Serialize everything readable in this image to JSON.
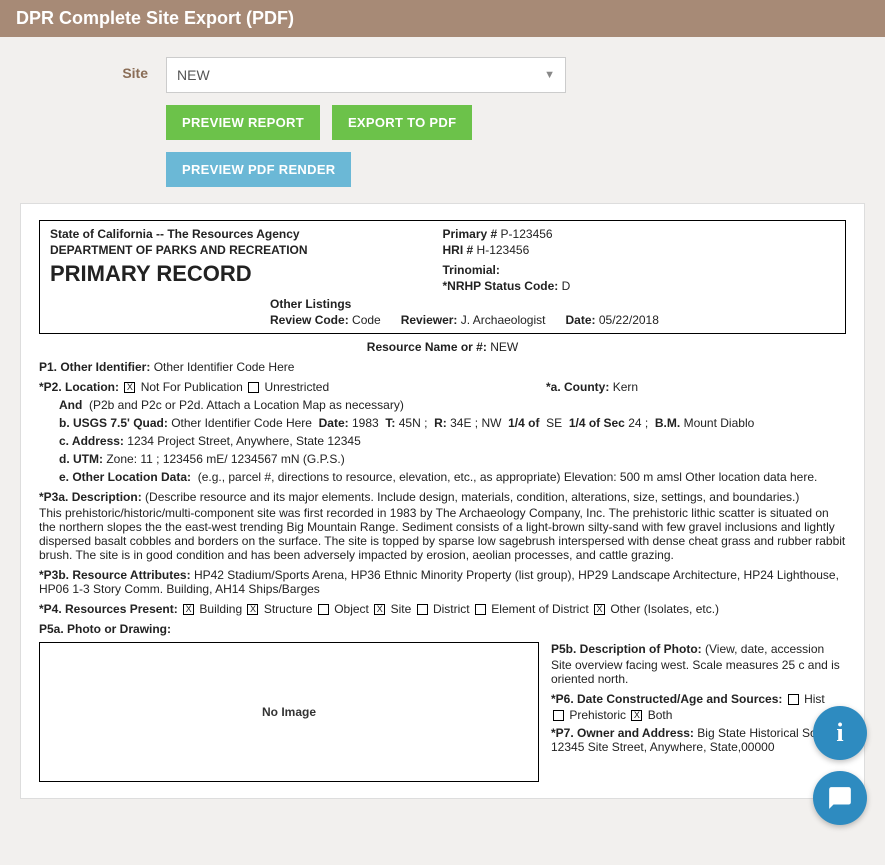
{
  "header": {
    "title": "DPR Complete Site Export (PDF)"
  },
  "controls": {
    "site_label": "Site",
    "site_value": "NEW",
    "btn_preview": "PREVIEW REPORT",
    "btn_export": "EXPORT TO PDF",
    "btn_render": "PREVIEW PDF RENDER"
  },
  "doc": {
    "agency": "State of California -- The Resources Agency",
    "dept": "DEPARTMENT OF PARKS AND RECREATION",
    "rec_title": "PRIMARY RECORD",
    "primary_label": "Primary #",
    "primary_val": "P-123456",
    "hri_label": "HRI #",
    "hri_val": "H-123456",
    "trinomial_label": "Trinomial:",
    "nrhp_label": "*NRHP Status Code:",
    "nrhp_val": "D",
    "other_listings": "Other Listings",
    "review_code_label": "Review Code:",
    "review_code_val": "Code",
    "reviewer_label": "Reviewer:",
    "reviewer_val": "J. Archaeologist",
    "date_label": "Date:",
    "date_val": "05/22/2018",
    "resname_label": "Resource Name or #:",
    "resname_val": "NEW",
    "p1_label": "P1. Other Identifier:",
    "p1_val": "Other Identifier Code Here",
    "p2_label": "*P2. Location:",
    "p2_nfp": "Not For Publication",
    "p2_unr": "Unrestricted",
    "p2a_label": "*a. County:",
    "p2a_val": "Kern",
    "p2_and": "And",
    "p2_and_note": "(P2b and P2c or P2d. Attach a Location Map as necessary)",
    "p2b_label": "b. USGS 7.5' Quad:",
    "p2b_val": "Other Identifier Code Here",
    "p2b_date_label": "Date:",
    "p2b_date_val": "1983",
    "p2b_t_label": "T:",
    "p2b_t_val": "45N ;",
    "p2b_r_label": "R:",
    "p2b_r_val": "34E ;  NW",
    "p2b_q1": "1/4 of",
    "p2b_q1_val": "SE",
    "p2b_q2": "1/4 of Sec",
    "p2b_q2_val": "24 ;",
    "p2b_bm_label": "B.M.",
    "p2b_bm_val": "Mount Diablo",
    "p2c_label": "c. Address:",
    "p2c_val": "1234 Project Street, Anywhere, State 12345",
    "p2d_label": "d. UTM:",
    "p2d_val": "Zone: 11 ; 123456 mE/ 1234567 mN (G.P.S.)",
    "p2e_label": "e. Other Location Data:",
    "p2e_note": "(e.g., parcel #, directions to resource, elevation, etc., as appropriate)  Elevation: 500 m amsl  Other location data here.",
    "p3a_label": "*P3a. Description:",
    "p3a_note": "(Describe resource and its major elements. Include design, materials, condition, alterations, size, settings, and boundaries.)",
    "p3a_body": "This prehistoric/historic/multi-component site was first recorded in 1983 by The Archaeology Company, Inc. The prehistoric lithic scatter is situated on the northern slopes the the east-west trending Big Mountain Range. Sediment consists of a light-brown silty-sand with few gravel inclusions and lightly dispersed basalt cobbles and borders on the surface. The site is topped by sparse low sagebrush interspersed with dense cheat grass and rubber rabbit brush. The site is in good condition and has been adversely impacted by erosion, aeolian processes, and cattle grazing.",
    "p3b_label": "*P3b. Resource Attributes:",
    "p3b_val": "HP42 Stadium/Sports Arena, HP36 Ethnic Minority Property (list group), HP29 Landscape Architecture, HP24 Lighthouse, HP06 1-3 Story Comm. Building, AH14 Ships/Barges",
    "p4_label": "*P4. Resources Present:",
    "p4_building": "Building",
    "p4_structure": "Structure",
    "p4_object": "Object",
    "p4_site": "Site",
    "p4_district": "District",
    "p4_element": "Element of District",
    "p4_other": "Other (Isolates, etc.)",
    "p5a": "P5a. Photo or Drawing:",
    "no_image": "No Image",
    "p5b_label": "P5b. Description of Photo:",
    "p5b_note": "(View, date, accession",
    "p5b_body": "Site overview facing west. Scale measures 25 c       and is oriented north.",
    "p6_label": "*P6. Date Constructed/Age and Sources:",
    "p6_hist": "Hist",
    "p6_pre": "Prehistoric",
    "p6_both": "Both",
    "p7_label": "*P7. Owner and Address:",
    "p7_val": "Big State Historical Soc       12345 Site Street, Anywhere, State,00000"
  },
  "fab": {
    "info": "i"
  }
}
